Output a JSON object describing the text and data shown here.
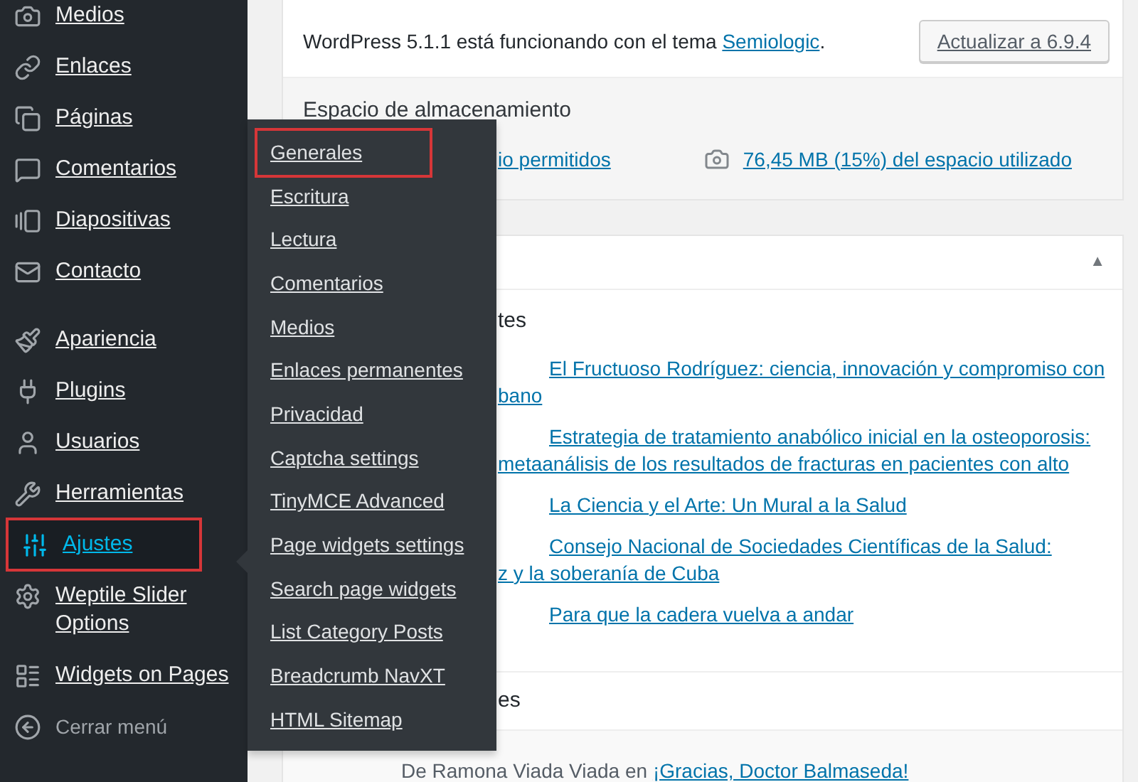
{
  "sidebar": {
    "groups": [
      {
        "items": [
          {
            "label": "Medios",
            "selected": false,
            "highlighted": false
          },
          {
            "label": "Enlaces",
            "selected": false,
            "highlighted": false
          },
          {
            "label": "Páginas",
            "selected": false,
            "highlighted": false
          },
          {
            "label": "Comentarios",
            "selected": false,
            "highlighted": false
          },
          {
            "label": "Diapositivas",
            "selected": false,
            "highlighted": false
          },
          {
            "label": "Contacto",
            "selected": false,
            "highlighted": false
          }
        ]
      },
      {
        "items": [
          {
            "label": "Apariencia",
            "selected": false,
            "highlighted": false
          },
          {
            "label": "Plugins",
            "selected": false,
            "highlighted": false
          },
          {
            "label": "Usuarios",
            "selected": false,
            "highlighted": false
          },
          {
            "label": "Herramientas",
            "selected": false,
            "highlighted": false
          },
          {
            "label": "Ajustes",
            "selected": true,
            "highlighted": true
          },
          {
            "label": "Weptile Slider Options",
            "selected": false,
            "highlighted": false
          },
          {
            "label": "Widgets on Pages",
            "selected": false,
            "highlighted": false
          }
        ]
      }
    ],
    "collapse": "Cerrar menú"
  },
  "submenu": {
    "items": [
      {
        "label": "Generales",
        "highlighted": true
      },
      {
        "label": "Escritura",
        "highlighted": false
      },
      {
        "label": "Lectura",
        "highlighted": false
      },
      {
        "label": "Comentarios",
        "highlighted": false
      },
      {
        "label": "Medios",
        "highlighted": false
      },
      {
        "label": "Enlaces permanentes",
        "highlighted": false
      },
      {
        "label": "Privacidad",
        "highlighted": false
      },
      {
        "label": "Captcha settings",
        "highlighted": false
      },
      {
        "label": "TinyMCE Advanced",
        "highlighted": false
      },
      {
        "label": "Page widgets settings",
        "highlighted": false
      },
      {
        "label": "Search page widgets",
        "highlighted": false
      },
      {
        "label": "List Category Posts",
        "highlighted": false
      },
      {
        "label": "Breadcrumb NavXT",
        "highlighted": false
      },
      {
        "label": "HTML Sitemap",
        "highlighted": false
      }
    ]
  },
  "status_card": {
    "text_before": "WordPress 5.1.1 está funcionando con el tema ",
    "theme_link": "Semiologic",
    "text_after": ".",
    "update_button": "Actualizar a 6.9.4",
    "storage_title": "Espacio de almacenamiento",
    "allowed_link": "io permitidos",
    "used_link": "76,45 MB (15%) del espacio utilizado"
  },
  "activity_card": {
    "toggle": "▲",
    "heading_1": "tes",
    "posts": [
      {
        "lines": [
          "El Fructuoso Rodríguez: ciencia, innovación y compromiso con",
          "bano"
        ]
      },
      {
        "lines": [
          "Estrategia de tratamiento anabólico inicial en la osteoporosis:",
          "metaanálisis de los resultados de fracturas en pacientes con alto"
        ]
      },
      {
        "lines": [
          "La Ciencia y el Arte: Un Mural a la Salud"
        ]
      },
      {
        "lines": [
          "Consejo Nacional de Sociedades Científicas de la Salud:",
          "z y la soberanía de Cuba"
        ]
      },
      {
        "lines": [
          "Para que la cadera vuelva a andar"
        ]
      }
    ],
    "heading_2": "es",
    "comment_prefix": "De Ramona Viada Viada en ",
    "comment_link": "¡Gracias, Doctor Balmaseda!"
  }
}
